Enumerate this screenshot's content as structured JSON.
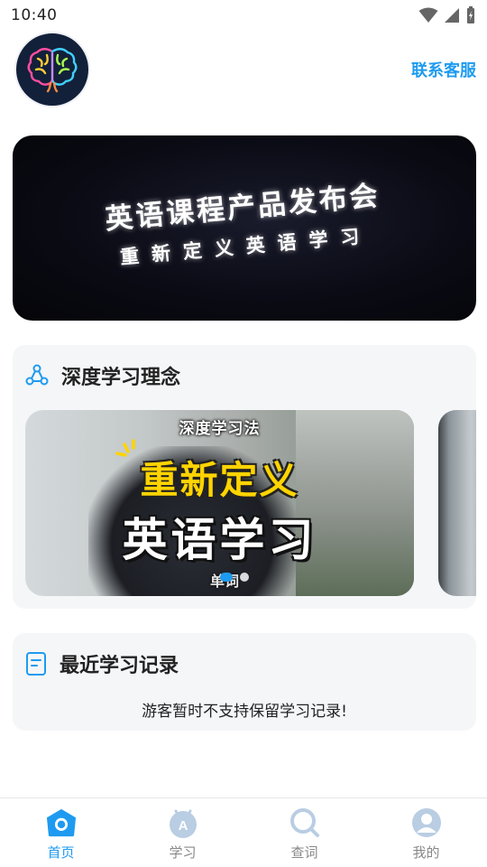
{
  "status_bar": {
    "time": "10:40"
  },
  "header": {
    "avatar_icon": "brain-icon",
    "contact_label": "联系客服"
  },
  "banner": {
    "title": "英语课程产品发布会",
    "subtitle": "重新定义英语学习"
  },
  "deep_learning": {
    "title": "深度学习理念",
    "icon": "molecule-icon",
    "carousel": {
      "tag": "深度学习法",
      "line1": "重新定义",
      "line2": "英语学习",
      "caption": "单词",
      "active_index": 0,
      "dot_count": 2
    }
  },
  "recent": {
    "title": "最近学习记录",
    "icon": "document-icon",
    "empty_text": "游客暂时不支持保留学习记录!"
  },
  "tab_bar": {
    "items": [
      {
        "label": "首页",
        "icon": "home-icon",
        "active": true
      },
      {
        "label": "学习",
        "icon": "study-icon",
        "active": false
      },
      {
        "label": "查词",
        "icon": "search-icon",
        "active": false
      },
      {
        "label": "我的",
        "icon": "profile-icon",
        "active": false
      }
    ]
  },
  "colors": {
    "accent": "#1e9bf0",
    "inactive_icon": "#b9cde3",
    "card_bg": "#f5f6f8"
  }
}
